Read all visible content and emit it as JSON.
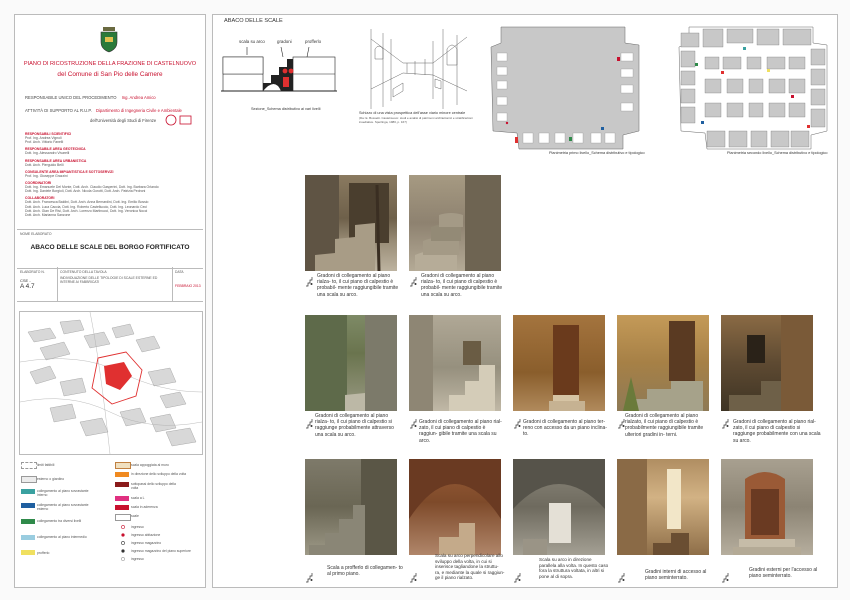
{
  "left_panel": {
    "title_line1": "PIANO DI RICOSTRUZIONE DELLA FRAZIONE DI CASTELNUOVO",
    "title_line2": "del Comune di San Pio delle Camere",
    "responsabile_label": "RESPONSABILE UNICO DEL PROCEDIMENTO",
    "responsabile_name": "Ing. Andrea Amico",
    "supporto_label": "ATTIVITÀ DI SUPPORTO AL R.U.P.",
    "supporto_dept": "Dipartimento di Ingegneria Civile e Ambientale",
    "supporto_univ": "dell'Università degli Studi di Firenze",
    "sections": [
      {
        "head": "RESPONSABILI SCIENTIFICI",
        "lines": [
          "Prof. Ing. Andrea Vignoli",
          "Prof. Arch. Vittorio Fanelli"
        ]
      },
      {
        "head": "RESPONSABILE AREA GEOTECNICA",
        "lines": [
          "Dott. Ing. Alessandro Vivarelli"
        ]
      },
      {
        "head": "RESPONSABILE AREA URBANISTICA",
        "lines": [
          "Dott. Arch. Pierguido Belli"
        ]
      },
      {
        "head": "CONSULENTE AREA IMPIANTISTICA E SOTTOSERVIZI",
        "lines": [
          "Prof. Ing. Giuseppe Grazzini"
        ]
      },
      {
        "head": "COORDINATORI",
        "lines": [
          "Dott. Ing. Emanuele Del Monte, Dott. Arch. Claudio Gasperini, Dott. Ing. Barbara Orlando",
          "Dott. Ing. Daniele Borgioli, Dott. Arch. Nicola Gorotti, Dott. Arch. Patrizia Pedroni"
        ]
      },
      {
        "head": "COLLABORATORI",
        "lines": [
          "Dott. Arch. Francesca Baldini, Dott. Arch. Anna Bernardini, Dott. Ing. Emilio Bossio",
          "Dott. Arch. Luca Caccia, Dott. Ing. Roberto Castelluccio, Dott. Ing. Leonardo Ceci",
          "Dott. Arch. Gian De Risi, Dott. Arch. Lorenzo Martinucci, Dott. Ing. Veronica Nocci",
          "Dott. Arch. Marianna Sanzone"
        ]
      }
    ],
    "nome_label": "NOME ELABORATO",
    "nome_value": "ABACO DELLE SCALE DEL BORGO FORTIFICATO",
    "col_elab_label": "ELABORATO N.",
    "col_elab_value1": "CSE -",
    "col_elab_value2": "A 4.7",
    "col_cont_label": "CONTENUTO DELLA TAVOLA",
    "col_cont_value": "INDIVIDUAZIONE DELLE TIPOLOGIE DI SCALE ESTERNE ED INTERNE AI FABBRICATI",
    "col_data_label": "DATA",
    "col_data_value": "FEBBRAIO 2013",
    "legend": {
      "left": [
        "limiti fattibili",
        "esterno o giardino",
        "collegamento al piano sovrastante interno",
        "collegamento al piano sovrastante esterno",
        "collegamento tra diversi livelli",
        "collegamento al piano intermedio",
        "profferlo"
      ],
      "right": [
        "scala appoggiata al muro",
        "in direzione dello sviluppo della volta",
        "sottopassi dello sviluppo della volta",
        "scala a L",
        "scala in aderenza",
        "scale",
        "ingresso",
        "ingresso abitazione",
        "ingresso magazzino",
        "ingresso magazzino del piano superiore",
        "ingresso"
      ]
    }
  },
  "right_panel": {
    "section_title": "ABACO DELLE SCALE",
    "diagram_labels": [
      "scala su arco",
      "gradoni",
      "profferlo"
    ],
    "diagram_caption": "Sezione_Schema distributivo ai vari livelli",
    "sketch_caption_1": "Schizzo di una vista prospettica dell'asse viario minore centrale",
    "sketch_caption_2": "(Da: E. Bussetti. Castelnuovo: studi e analisi di patrimoni architettonici e stratificazioni insediative. Sperlinga, 1980, p. 167)",
    "plan1_caption": "Planimetria primo livello_Schema distributivo e tipologico",
    "plan2_caption": "Planimetria secondo livello_Schema distributivo e tipologico",
    "row1_captions": [
      "Gradoni di collegamento al piano rialza- to, il cui piano di calpestio è probabil- mente raggiungibile tramite una scala su arco.",
      "Gradoni di collegamento al piano rialza- to, il cui piano di calpestio è probabil- mente raggiungibile tramite una scala su arco."
    ],
    "row2_captions": [
      "Gradoni di collegamento al piano rialza- to, il cui piano di calpestio si raggiunge probabilmente attraverso una scala su arco.",
      "Gradoni di collegamento al piano rial- zato, il cui piano di calpestio è raggiun- gibile tramite una scala su arco.",
      "Gradoni di collegamento al piano ter- reno con accesso da un piano inclina- to.",
      "Gradoni di collegamento al piano rialzato, il cui piano di calpestio è probabilmente raggiungibile tramite ulteriori gradini in- terni.",
      "Gradoni di collegamento al piano rial- zato, il cui piano di calpestio si raggiunge probabilmente con una scala su arco."
    ],
    "row3_captions": [
      "Scala a profferlo di collegamen- to al primo piano.",
      "Scala su arco perpendicolare allo sviluppo della volta, in cui si inserisce tagliandone la struttu- ra, e mediante la quale si raggiun- ge il piano rialzato.",
      "Scala su arco in direzione parallela alla volta. In questo caso fora la struttura voltata, in altri si pone al di sopra.",
      "Gradini interni di accesso al piano seminterrato.",
      "Gradini esterni per l'accesso al piano seminterrato."
    ]
  },
  "colors": {
    "accent_red": "#c8102e",
    "building_red": "#e03030",
    "plan_gray": "#c8c8c8"
  }
}
